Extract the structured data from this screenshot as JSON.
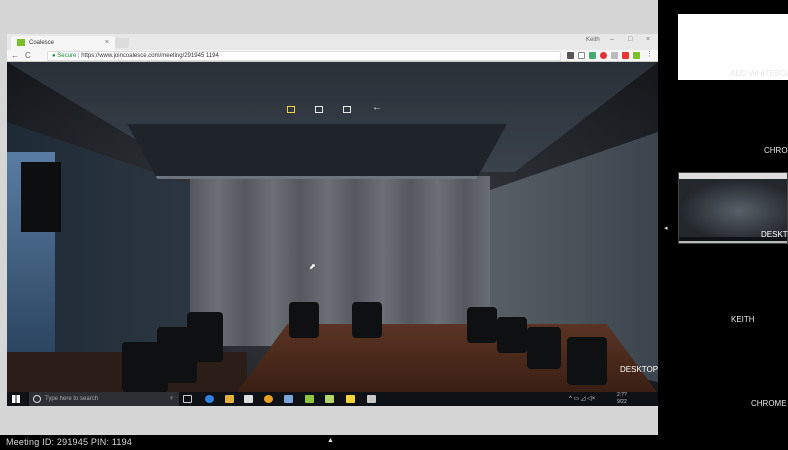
{
  "browser": {
    "tab_title": "Coalesce",
    "tab_close": "×",
    "window_user": "Keith",
    "window_controls": [
      "–",
      "□",
      "×"
    ],
    "nav": [
      "←",
      "C"
    ],
    "secure_label": "Secure",
    "url": "https://www.joincoalesce.com/meeting/291945 1194"
  },
  "meeting_toolbar": {
    "icons": [
      "present-icon",
      "screen-icon",
      "copy-icon",
      "back-arrow-icon"
    ],
    "back_arrow": "←"
  },
  "taskbar": {
    "search_placeholder": "Type here to search",
    "mic": "♀",
    "tray_icons": "^ ▭ ◿ ◁×",
    "time": "2:??",
    "date": "9/22"
  },
  "shared_screen_label": "DESKTOP",
  "status": {
    "meeting_text": "Meeting ID: 291945    PIN: 1194",
    "expand_caret": "▲"
  },
  "sidebar": {
    "collapse_arrow": "◂",
    "items": [
      {
        "label": "ADD WHITEBOARD"
      },
      {
        "label": "CHROME"
      },
      {
        "label": "DESKTOP"
      },
      {
        "label": "KEITH"
      },
      {
        "label": "CHROME C"
      }
    ]
  },
  "colors": {
    "accent_yellow": "#f2d33a",
    "chrome_green": "#7cbf2a",
    "secure_green": "#1a8a3a"
  }
}
